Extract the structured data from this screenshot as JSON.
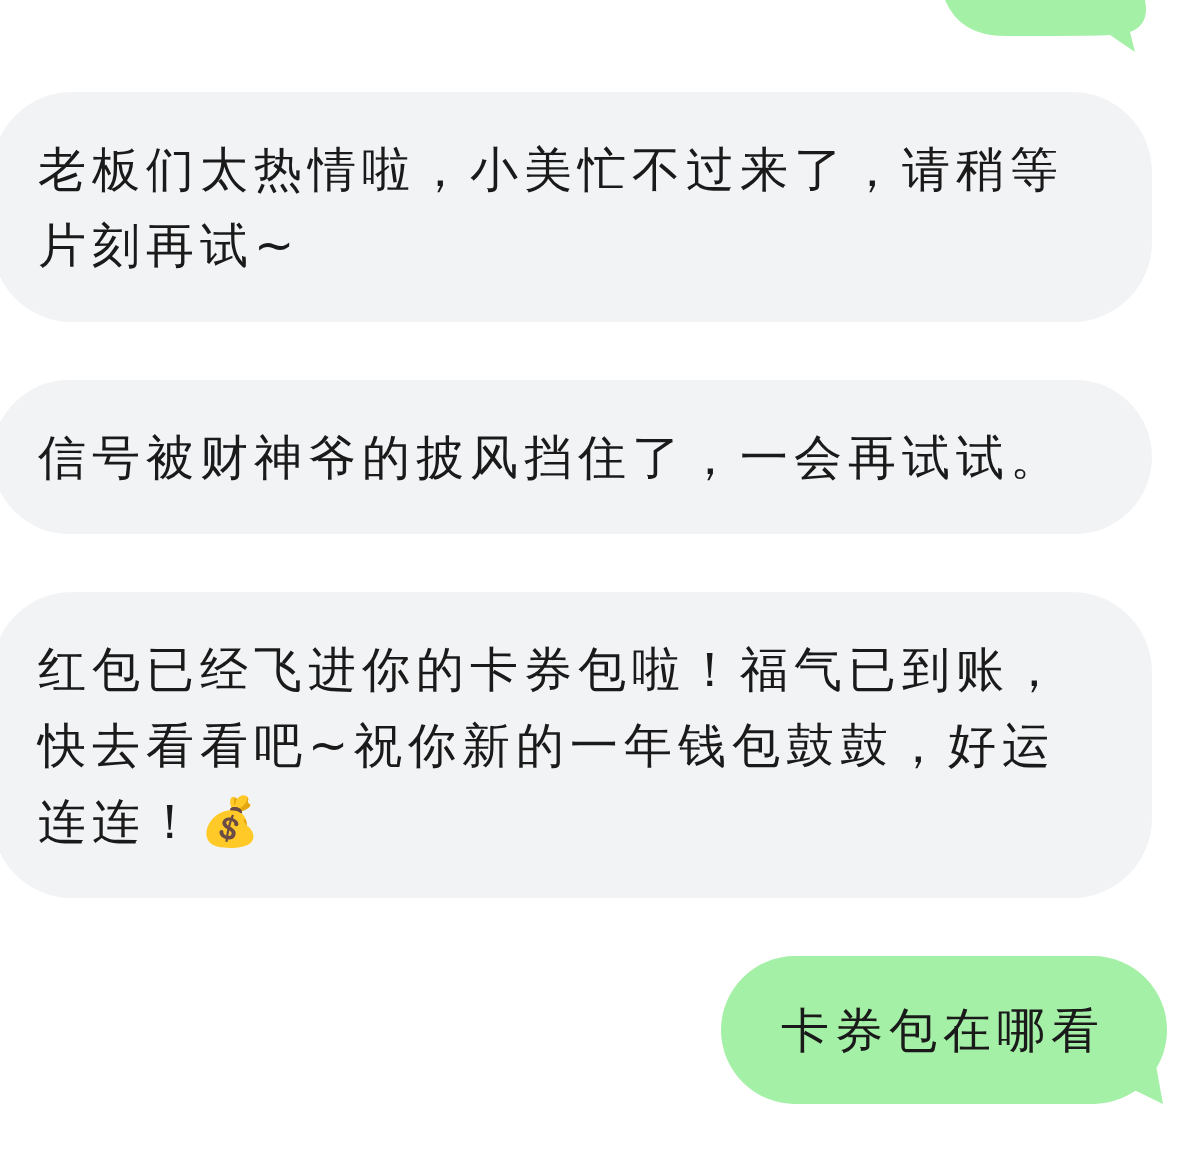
{
  "messages": [
    {
      "kind": "received",
      "text": "老板们太热情啦，小美忙不过来了，请稍等片刻再试~"
    },
    {
      "kind": "received",
      "text": "信号被财神爷的披风挡住了，一会再试试。"
    },
    {
      "kind": "received",
      "text": "红包已经飞进你的卡券包啦！福气已到账，快去看看吧~祝你新的一年钱包鼓鼓，好运连连！💰"
    },
    {
      "kind": "sent",
      "text": "卡券包在哪看"
    }
  ]
}
